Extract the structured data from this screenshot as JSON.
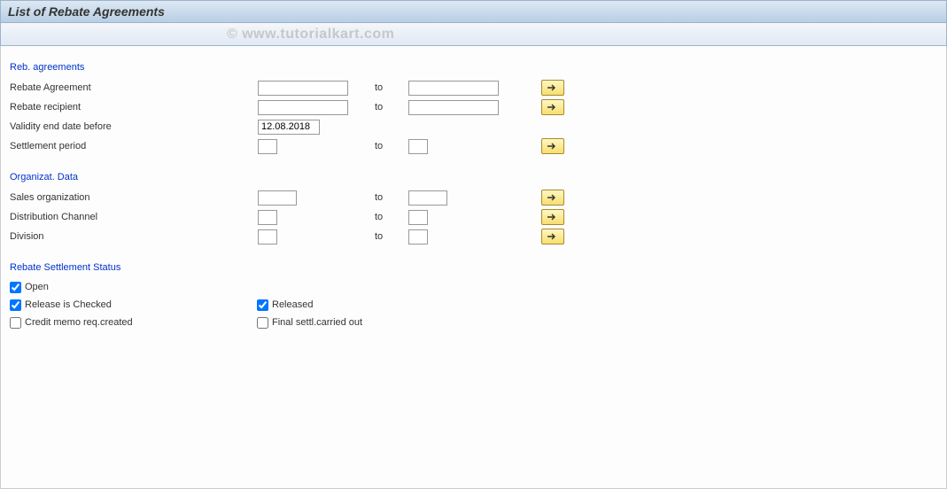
{
  "header": {
    "title": "List of Rebate Agreements",
    "watermark": "© www.tutorialkart.com"
  },
  "sections": {
    "reb_agreements": {
      "title": "Reb. agreements",
      "rows": {
        "rebate_agreement": {
          "label": "Rebate Agreement",
          "to": "to",
          "from_val": "",
          "to_val": ""
        },
        "rebate_recipient": {
          "label": "Rebate recipient",
          "to": "to",
          "from_val": "",
          "to_val": ""
        },
        "validity_end": {
          "label": "Validity end date before",
          "value": "12.08.2018"
        },
        "settlement_period": {
          "label": "Settlement period",
          "to": "to",
          "from_val": "",
          "to_val": ""
        }
      }
    },
    "org_data": {
      "title": "Organizat. Data",
      "rows": {
        "sales_org": {
          "label": "Sales organization",
          "to": "to",
          "from_val": "",
          "to_val": ""
        },
        "dist_channel": {
          "label": "Distribution Channel",
          "to": "to",
          "from_val": "",
          "to_val": ""
        },
        "division": {
          "label": "Division",
          "to": "to",
          "from_val": "",
          "to_val": ""
        }
      }
    },
    "settlement_status": {
      "title": "Rebate Settlement Status",
      "checkboxes": {
        "open": {
          "label": "Open",
          "checked": true
        },
        "release_checked": {
          "label": "Release is Checked",
          "checked": true
        },
        "released": {
          "label": "Released",
          "checked": true
        },
        "credit_memo": {
          "label": "Credit memo req.created",
          "checked": false
        },
        "final_settl": {
          "label": "Final settl.carried out",
          "checked": false
        }
      }
    }
  }
}
